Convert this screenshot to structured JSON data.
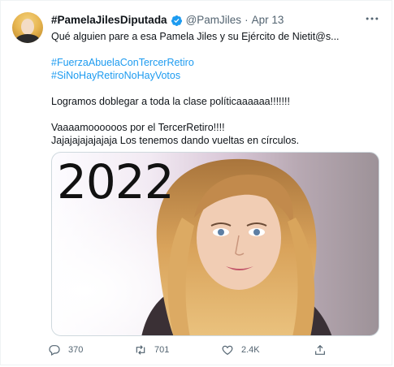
{
  "tweet": {
    "display_name": "#PamelaJilesDiputada",
    "handle": "@PamJiles",
    "separator": "·",
    "date": "Apr 13",
    "lines": [
      "Qué alguien pare a esa Pamela Jiles y su Ejército de Nietit@s..."
    ],
    "hashtags": [
      "#FuerzaAbuelaConTercerRetiro",
      "#SiNoHayRetiroNoHayVotos"
    ],
    "paragraph_2": "Logramos doblegar a toda la clase políticaaaaaa!!!!!!!",
    "paragraph_3_line_1": "Vaaaamoooooos por el TercerRetiro!!!!",
    "paragraph_3_line_2": "Jajajajajajajaja Los tenemos dando vueltas en círculos.",
    "media_text": "2022"
  },
  "actions": {
    "replies": "370",
    "retweets": "701",
    "likes": "2.4K"
  },
  "icons": {
    "verified": "verified-badge-icon",
    "more": "more-options-icon",
    "reply": "reply-icon",
    "retweet": "retweet-icon",
    "like": "heart-icon",
    "share": "share-icon"
  },
  "colors": {
    "link": "#1d9bf0",
    "secondary_text": "#536471",
    "verified": "#1d9bf0"
  }
}
